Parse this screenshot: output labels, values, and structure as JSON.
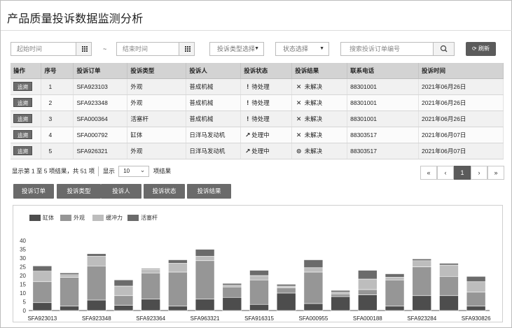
{
  "page": {
    "title": "产品质量投诉数据监测分析"
  },
  "filters": {
    "start_placeholder": "起始时间",
    "separator": "~",
    "end_placeholder": "结束时间",
    "type_select": "投诉类型选择",
    "status_select": "状态选择",
    "search_placeholder": "搜索投诉订单编号",
    "refresh_label": "刷新"
  },
  "table": {
    "headers": [
      "操作",
      "序号",
      "投诉订单",
      "投诉类型",
      "投诉人",
      "投诉状态",
      "投诉结果",
      "联系电话",
      "投诉时间"
    ],
    "action_label": "追溯",
    "rows": [
      {
        "seq": "1",
        "order": "SFA923103",
        "type": "外观",
        "person": "普成机械",
        "status_icon": "!",
        "status": "待处理",
        "result_icon": "✕",
        "result": "未解决",
        "phone": "88301001",
        "time": "2021年06月26日"
      },
      {
        "seq": "2",
        "order": "SFA923348",
        "type": "外观",
        "person": "普成机械",
        "status_icon": "!",
        "status": "待处理",
        "result_icon": "✕",
        "result": "未解决",
        "phone": "88301001",
        "time": "2021年06月26日"
      },
      {
        "seq": "3",
        "order": "SFA000364",
        "type": "活塞杆",
        "person": "普成机械",
        "status_icon": "!",
        "status": "待处理",
        "result_icon": "✕",
        "result": "未解决",
        "phone": "88301001",
        "time": "2021年06月26日"
      },
      {
        "seq": "4",
        "order": "SFA000792",
        "type": "缸体",
        "person": "日洋马发动机",
        "status_icon": "↗",
        "status": "处理中",
        "result_icon": "✕",
        "result": "未解决",
        "phone": "88303517",
        "time": "2021年06月07日"
      },
      {
        "seq": "5",
        "order": "SFA926321",
        "type": "外观",
        "person": "日洋马发动机",
        "status_icon": "↗",
        "status": "处理中",
        "result_icon": "⊙",
        "result": "未解决",
        "phone": "88303517",
        "time": "2021年06月07日"
      }
    ]
  },
  "pagination": {
    "summary": "显示第 1 至 5 项结果，共 51 项",
    "show_label": "显示",
    "page_size": "10",
    "unit_label": "项结果",
    "buttons": [
      "«",
      "‹",
      "1",
      "›",
      "»"
    ]
  },
  "tabs": [
    "投诉订单",
    "投诉类型",
    "投诉人",
    "投诉状态",
    "投诉结果"
  ],
  "colors": {
    "dark": "#4d4d4d",
    "mid": "#969696",
    "light": "#bdbdbd",
    "darker": "#6b6b6b"
  },
  "chart_data": {
    "type": "bar",
    "stacked": true,
    "legend": [
      "缸体",
      "外观",
      "缓冲力",
      "活塞杆"
    ],
    "legend_position": "top-left",
    "x_tick_labels": [
      "SFA923013",
      "SFA923348",
      "SFA923364",
      "SFA963321",
      "SFA916315",
      "SFA000955",
      "SFA000188",
      "SFA923284",
      "SFA930826"
    ],
    "ylim": [
      0,
      40
    ],
    "y_ticks": [
      0,
      5,
      10,
      15,
      20,
      25,
      30,
      35,
      40
    ],
    "grid": false,
    "series": [
      {
        "name": "缸体",
        "values": [
          4.5,
          2.5,
          6,
          3,
          6.5,
          2.5,
          6.5,
          7.5,
          3.5,
          10,
          4,
          8,
          9,
          2.5,
          8.5,
          8.5,
          2.5
        ]
      },
      {
        "name": "外观",
        "values": [
          12,
          16.5,
          19.5,
          5.5,
          15,
          19.5,
          22,
          6,
          14,
          3,
          18,
          1.5,
          3,
          15,
          16.5,
          11,
          8
        ]
      },
      {
        "name": "缓冲力",
        "values": [
          6,
          1.5,
          5.5,
          5.5,
          2,
          5,
          2.5,
          1,
          2.5,
          1,
          2.5,
          1,
          6,
          1.5,
          3.5,
          6.5,
          6
        ]
      },
      {
        "name": "活塞杆",
        "values": [
          3,
          1,
          1.5,
          3.5,
          0.5,
          2,
          4,
          1,
          3,
          1,
          4.5,
          1,
          5,
          2,
          1,
          1,
          3
        ]
      }
    ]
  }
}
